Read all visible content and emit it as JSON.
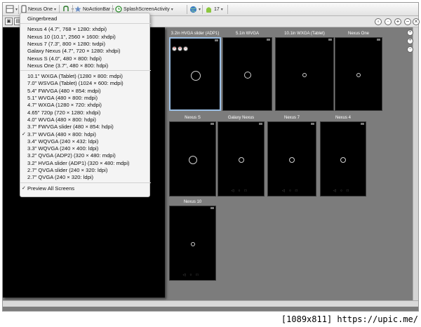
{
  "toolbar": {
    "device_select": "Nexus One",
    "theme_select": "NoActionBar",
    "activity_select": "SplashScreenActivity",
    "api_level": "17",
    "icons": [
      "layout-icon",
      "phone-icon",
      "orientation-icon",
      "star-icon",
      "activity-icon",
      "globe-icon",
      "android-icon"
    ]
  },
  "menu": {
    "groups": [
      {
        "items": [
          {
            "label": "Gingerbread",
            "checked": false
          }
        ]
      },
      {
        "items": [
          {
            "label": "Nexus 4 (4.7\", 768 × 1280: xhdpi)",
            "checked": false
          },
          {
            "label": "Nexus 10 (10.1\", 2560 × 1600: xhdpi)",
            "checked": false
          },
          {
            "label": "Nexus 7 (7.3\", 800 × 1280: tvdpi)",
            "checked": false
          },
          {
            "label": "Galaxy Nexus (4.7\", 720 × 1280: xhdpi)",
            "checked": false
          },
          {
            "label": "Nexus S (4.0\", 480 × 800: hdpi)",
            "checked": false
          },
          {
            "label": "Nexus One (3.7\", 480 × 800: hdpi)",
            "checked": false
          }
        ]
      },
      {
        "items": [
          {
            "label": "10.1\" WXGA (Tablet) (1280 × 800: mdpi)",
            "checked": false
          },
          {
            "label": "7.0\" WSVGA (Tablet) (1024 × 600: mdpi)",
            "checked": false
          },
          {
            "label": "5.4\" FWVGA (480 × 854: mdpi)",
            "checked": false
          },
          {
            "label": "5.1\" WVGA (480 × 800: mdpi)",
            "checked": false
          },
          {
            "label": "4.7\" WXGA (1280 × 720: xhdpi)",
            "checked": false
          },
          {
            "label": "4.65\" 720p (720 × 1280: xhdpi)",
            "checked": false
          },
          {
            "label": "4.0\" WVGA (480 × 800: hdpi)",
            "checked": false
          },
          {
            "label": "3.7\" FWVGA slider (480 × 854: hdpi)",
            "checked": false
          },
          {
            "label": "3.7\" WVGA (480 × 800: hdpi)",
            "checked": true
          },
          {
            "label": "3.4\" WQVGA (240 × 432: ldpi)",
            "checked": false
          },
          {
            "label": "3.3\" WQVGA (240 × 400: ldpi)",
            "checked": false
          },
          {
            "label": "3.2\" QVGA (ADP2) (320 × 480: mdpi)",
            "checked": false
          },
          {
            "label": "3.2\" HVGA slider (ADP1) (320 × 480: mdpi)",
            "checked": false
          },
          {
            "label": "2.7\" QVGA slider (240 × 320: ldpi)",
            "checked": false
          },
          {
            "label": "2.7\" QVGA (240 × 320: ldpi)",
            "checked": false
          }
        ]
      },
      {
        "items": [
          {
            "label": "Preview All Screens",
            "checked": true
          }
        ]
      }
    ]
  },
  "previews": [
    {
      "label": "3.2in HVGA slider (ADP1)",
      "selected": true
    },
    {
      "label": "5.1in WVGA",
      "selected": false
    },
    {
      "label": "10.1in WXGA (Tablet)",
      "selected": false
    },
    {
      "label": "Nexus One",
      "selected": false
    },
    {
      "label": "Nexus S",
      "selected": false
    },
    {
      "label": "Galaxy Nexus",
      "selected": false
    },
    {
      "label": "Nexus 7",
      "selected": false
    },
    {
      "label": "Nexus 4",
      "selected": false
    },
    {
      "label": "Nexus 10",
      "selected": false
    }
  ],
  "caption": "[1089x811] https://upic.me/"
}
